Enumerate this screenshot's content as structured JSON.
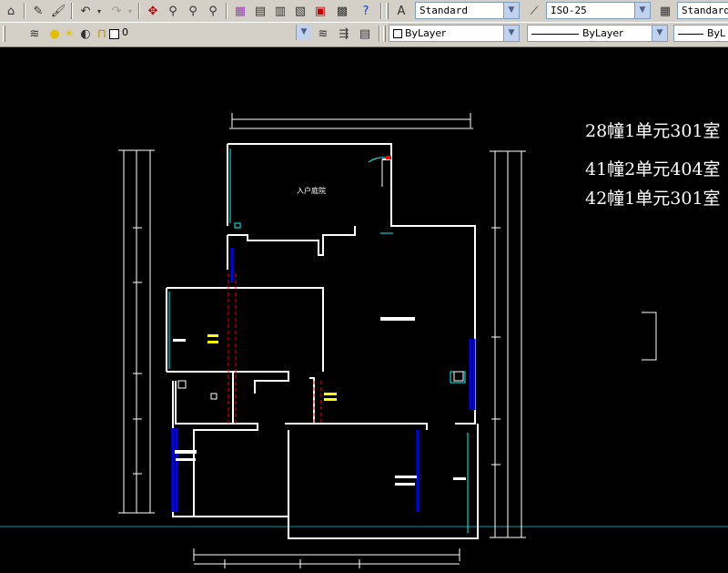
{
  "toolbar_top": {
    "text_style": "Standard",
    "dim_style": "ISO-25",
    "table_style": "Standard"
  },
  "toolbar_layers": {
    "layer_name": "0",
    "color": "ByLayer",
    "linetype": "ByLayer",
    "lineweight": "ByL"
  },
  "drawing": {
    "titles": [
      "28幢1单元301室",
      "41幢2单元404室",
      "42幢1单元301室"
    ],
    "room_labels": {
      "entrance": "入户庭院"
    }
  },
  "colors": {
    "background": "#000000",
    "toolbar": "#d4d0c8",
    "wall": "#ffffff",
    "window": "#0000ff",
    "cyan_lines": "#00ffff",
    "yellow_tags": "#ffff00",
    "red_dashed": "#ff0000"
  }
}
